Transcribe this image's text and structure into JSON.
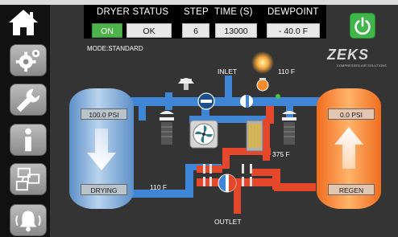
{
  "status_panel": {
    "headers": [
      "DRYER STATUS",
      "STEP",
      "TIME (S)",
      "DEWPOINT"
    ],
    "dryer_on": "ON",
    "dryer_status": "OK",
    "step": "6",
    "time_s": "13000",
    "dewpoint": "- 40.0  F"
  },
  "mode": "MODE:STANDARD",
  "brand": {
    "name": "ZEKS",
    "tagline": "COMPRESSED AIR SOLUTIONS"
  },
  "sidebar": {
    "items": [
      {
        "icon": "home-icon"
      },
      {
        "icon": "gears-icon"
      },
      {
        "icon": "wrench-icon"
      },
      {
        "icon": "info-icon"
      },
      {
        "icon": "network-icon"
      },
      {
        "icon": "alarm-bell-icon"
      }
    ]
  },
  "diagram": {
    "inlet_label": "INLET",
    "outlet_label": "OUTLET",
    "heater_temp": "110 F",
    "regen_temp": "375 F",
    "outlet_temp": "110 F",
    "left_tower": {
      "pressure": "100.0 PSI",
      "state": "DRYING"
    },
    "right_tower": {
      "pressure": "0.0 PSI",
      "state": "REGEN"
    }
  },
  "colors": {
    "power_button": "#3fb54a",
    "on_indicator": "#4eb34a",
    "process_air": "#3f86d6",
    "regen_air": "#e4472a",
    "drying_tower": "#7aa8d8",
    "regen_tower": "#f07a2a"
  }
}
